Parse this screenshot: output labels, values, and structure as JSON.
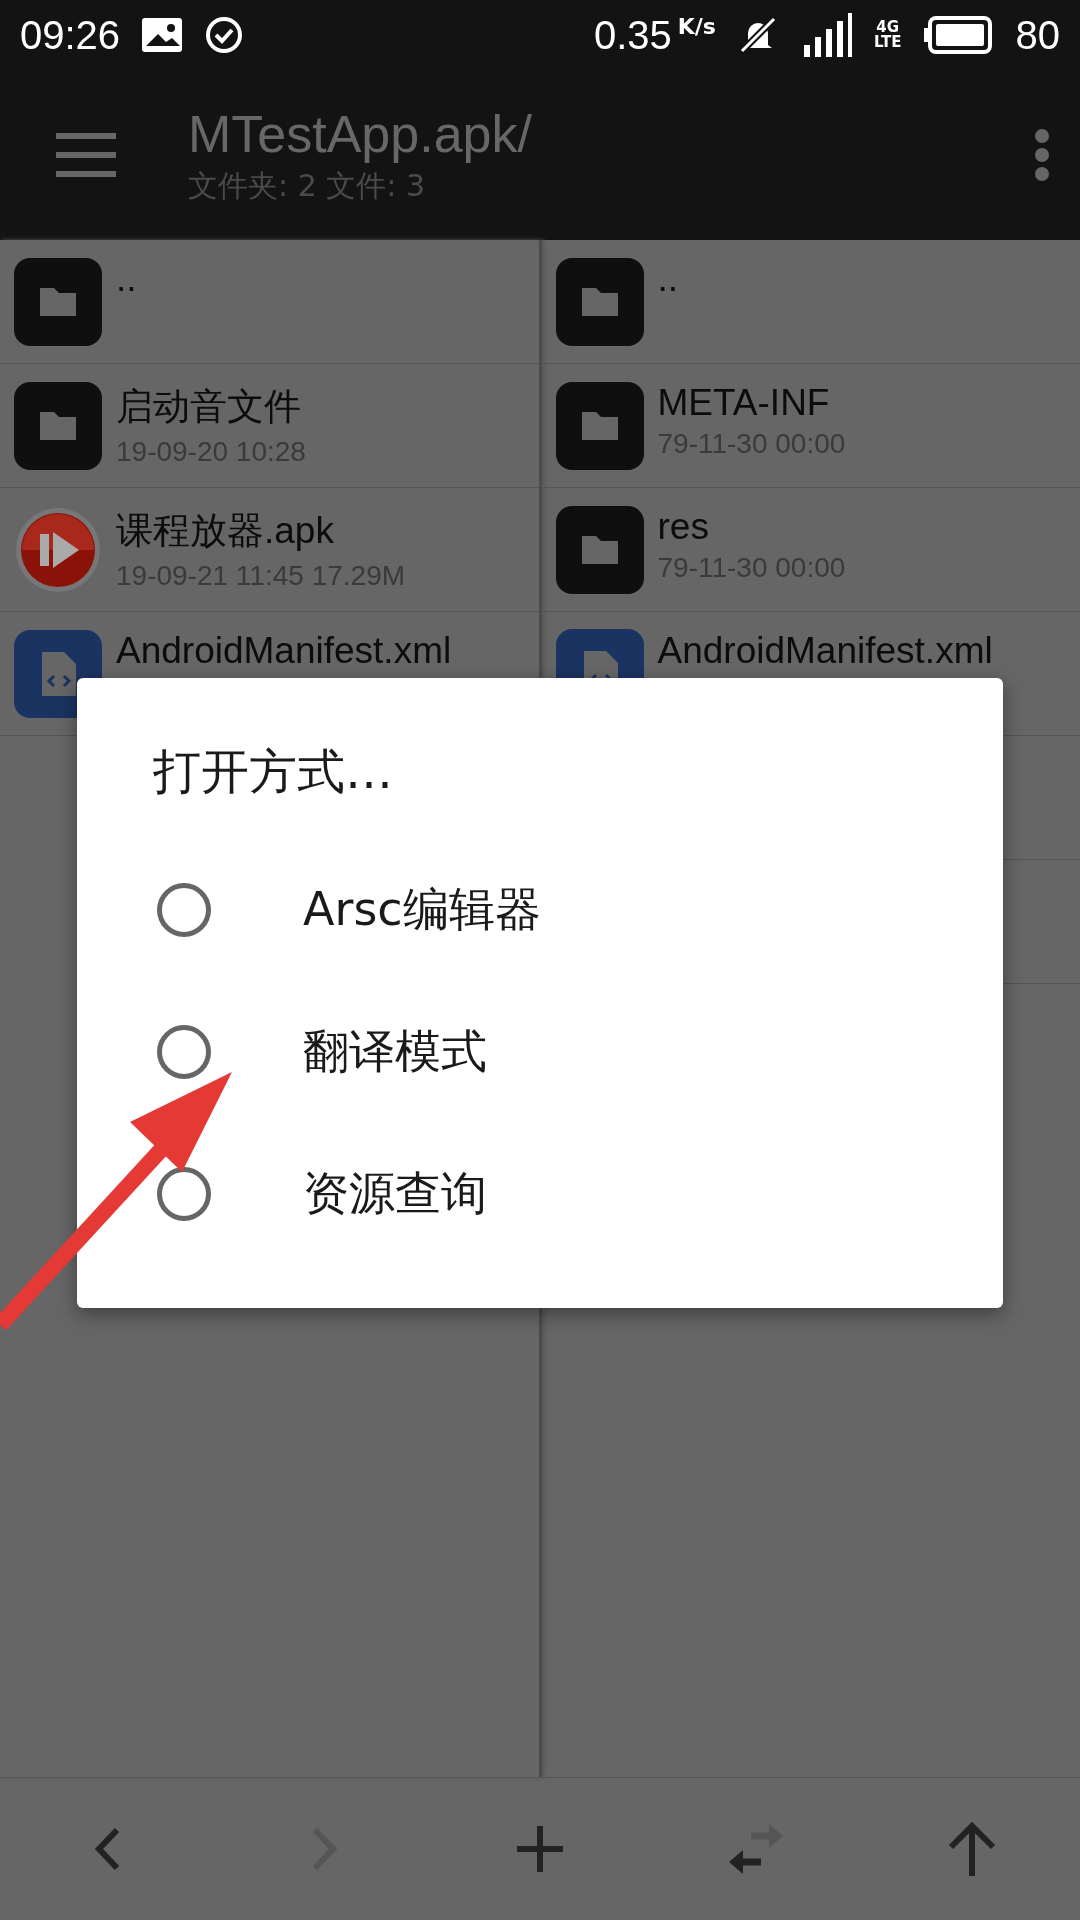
{
  "status_bar": {
    "time": "09:26",
    "speed": "0.35",
    "speed_unit": "K/s",
    "network": "4G",
    "network_sub": "LTE",
    "battery": "80"
  },
  "toolbar": {
    "title": "MTestApp.apk/",
    "subtitle": "文件夹: 2  文件: 3"
  },
  "panels": [
    {
      "rows": [
        {
          "kind": "folder",
          "name": ".."
        },
        {
          "kind": "folder",
          "name": "启动音文件",
          "meta": "19-09-20 10:28"
        },
        {
          "kind": "apk",
          "name": "课程放器.apk",
          "meta": "19-09-21 11:45  17.29M"
        },
        {
          "kind": "xml",
          "name": "AndroidManifest.xml"
        }
      ]
    },
    {
      "rows": [
        {
          "kind": "folder",
          "name": ".."
        },
        {
          "kind": "folder",
          "name": "META-INF",
          "meta": "79-11-30 00:00"
        },
        {
          "kind": "folder",
          "name": "res",
          "meta": "79-11-30 00:00"
        },
        {
          "kind": "xml",
          "name": "AndroidManifest.xml"
        }
      ]
    }
  ],
  "bottom_bar": [
    {
      "kind": "back",
      "disabled": false
    },
    {
      "kind": "forward",
      "disabled": true
    },
    {
      "kind": "add",
      "disabled": false
    },
    {
      "kind": "swap",
      "disabled": false
    },
    {
      "kind": "up",
      "disabled": false
    }
  ],
  "dialog": {
    "title": "打开方式…",
    "options": [
      {
        "label": "Arsc编辑器",
        "selected": false
      },
      {
        "label": "翻译模式",
        "selected": false
      },
      {
        "label": "资源查询",
        "selected": false
      }
    ]
  }
}
